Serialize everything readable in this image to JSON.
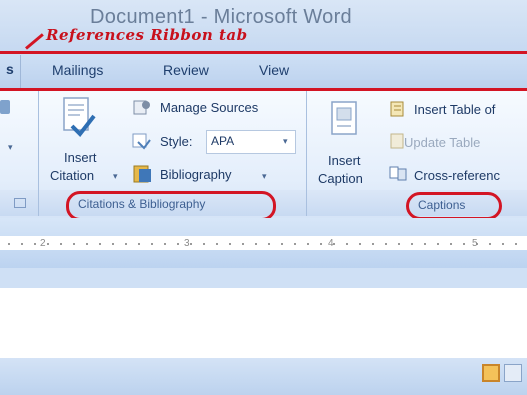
{
  "window": {
    "title": "Document1 - Microsoft Word"
  },
  "annotation": {
    "label": "References Ribbon tab"
  },
  "tabs": {
    "cut_label": "s",
    "mailings": "Mailings",
    "review": "Review",
    "view": "View"
  },
  "ribbon": {
    "citations_group": {
      "insert_citation_line1": "Insert",
      "insert_citation_line2": "Citation",
      "manage_sources": "Manage Sources",
      "style_label": "Style:",
      "style_value": "APA",
      "bibliography": "Bibliography",
      "group_label": "Citations & Bibliography"
    },
    "captions_group": {
      "insert_caption_line1": "Insert",
      "insert_caption_line2": "Caption",
      "insert_table_of_figures": "Insert Table of",
      "update_table": "Update Table",
      "cross_reference": "Cross-referenc",
      "group_label": "Captions"
    }
  },
  "ruler": {
    "ticks": [
      "2",
      "3",
      "4",
      "5"
    ]
  },
  "colors": {
    "annotation_red": "#d31524",
    "ribbon_blue": "#c6d9f1"
  }
}
